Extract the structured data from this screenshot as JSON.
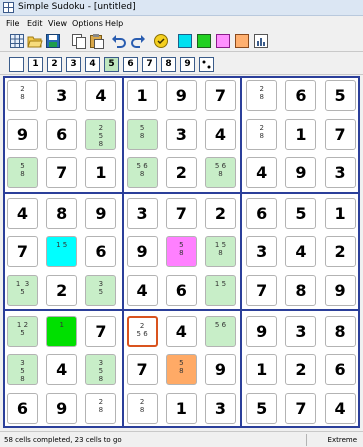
{
  "window": {
    "title": "Simple Sudoku - [untitled]"
  },
  "menu": [
    "File",
    "Edit",
    "View",
    "Options",
    "Help"
  ],
  "toolbar_icons": [
    "grid-icon",
    "open-folder-icon",
    "save-icon",
    "copy-icon",
    "paste-icon",
    "undo-icon",
    "redo-icon",
    "hint-icon",
    "highlight-cyan-icon",
    "highlight-green-icon",
    "highlight-pink-icon",
    "highlight-orange-icon",
    "statistics-icon"
  ],
  "highlight_colors": {
    "cyan": "#00ffff",
    "green": "#00e000",
    "pink": "#ff80ff",
    "orange": "#ffaa66",
    "candidate": "#c8eec8"
  },
  "number_buttons": [
    "1",
    "2",
    "3",
    "4",
    "5",
    "6",
    "7",
    "8",
    "9"
  ],
  "active_number": "5",
  "grid": [
    [
      {
        "n": "2\n8"
      },
      {
        "v": "3"
      },
      {
        "v": "4"
      },
      {
        "v": "1"
      },
      {
        "v": "9"
      },
      {
        "v": "7"
      },
      {
        "n": "2\n8"
      },
      {
        "v": "6"
      },
      {
        "v": "5"
      }
    ],
    [
      {
        "v": "9"
      },
      {
        "v": "6"
      },
      {
        "n": "2\n5\n8",
        "c": "candidate"
      },
      {
        "n": "5\n8",
        "c": "candidate"
      },
      {
        "v": "3"
      },
      {
        "v": "4"
      },
      {
        "n": "2\n8"
      },
      {
        "v": "1"
      },
      {
        "v": "7"
      }
    ],
    [
      {
        "n": "5\n8",
        "c": "candidate"
      },
      {
        "v": "7"
      },
      {
        "v": "1"
      },
      {
        "n": "5 6\n8",
        "c": "candidate"
      },
      {
        "v": "2"
      },
      {
        "n": "5 6\n8",
        "c": "candidate"
      },
      {
        "v": "4"
      },
      {
        "v": "9"
      },
      {
        "v": "3"
      }
    ],
    [
      {
        "v": "4"
      },
      {
        "v": "8"
      },
      {
        "v": "9"
      },
      {
        "v": "3"
      },
      {
        "v": "7"
      },
      {
        "v": "2"
      },
      {
        "v": "6"
      },
      {
        "v": "5"
      },
      {
        "v": "1"
      }
    ],
    [
      {
        "v": "7"
      },
      {
        "n": "1 5",
        "c": "cyan"
      },
      {
        "v": "6"
      },
      {
        "v": "9"
      },
      {
        "n": "5\n8",
        "c": "pink"
      },
      {
        "n": "1 5\n8",
        "c": "candidate"
      },
      {
        "v": "3"
      },
      {
        "v": "4"
      },
      {
        "v": "2"
      }
    ],
    [
      {
        "n": "1  3\n5",
        "c": "candidate"
      },
      {
        "v": "2"
      },
      {
        "n": "3\n5",
        "c": "candidate"
      },
      {
        "v": "4"
      },
      {
        "v": "6"
      },
      {
        "n": "1 5",
        "c": "candidate"
      },
      {
        "v": "7"
      },
      {
        "v": "8"
      },
      {
        "v": "9"
      }
    ],
    [
      {
        "n": "1 2\n5",
        "c": "candidate"
      },
      {
        "n": "1",
        "c": "green"
      },
      {
        "v": "7"
      },
      {
        "n": "2\n5 6",
        "sel": true
      },
      {
        "v": "4"
      },
      {
        "n": "5 6",
        "c": "candidate"
      },
      {
        "v": "9"
      },
      {
        "v": "3"
      },
      {
        "v": "8"
      }
    ],
    [
      {
        "n": "3\n5\n8",
        "c": "candidate"
      },
      {
        "v": "4"
      },
      {
        "n": "3\n5\n8",
        "c": "candidate"
      },
      {
        "v": "7"
      },
      {
        "n": "5\n8",
        "c": "orange"
      },
      {
        "v": "9"
      },
      {
        "v": "1"
      },
      {
        "v": "2"
      },
      {
        "v": "6"
      }
    ],
    [
      {
        "v": "6"
      },
      {
        "v": "9"
      },
      {
        "n": "2\n8"
      },
      {
        "n": "2\n8"
      },
      {
        "v": "1"
      },
      {
        "v": "3"
      },
      {
        "v": "5"
      },
      {
        "v": "7"
      },
      {
        "v": "4"
      }
    ]
  ],
  "status": {
    "left": "58 cells completed, 23 cells to go",
    "right": "Extreme"
  }
}
